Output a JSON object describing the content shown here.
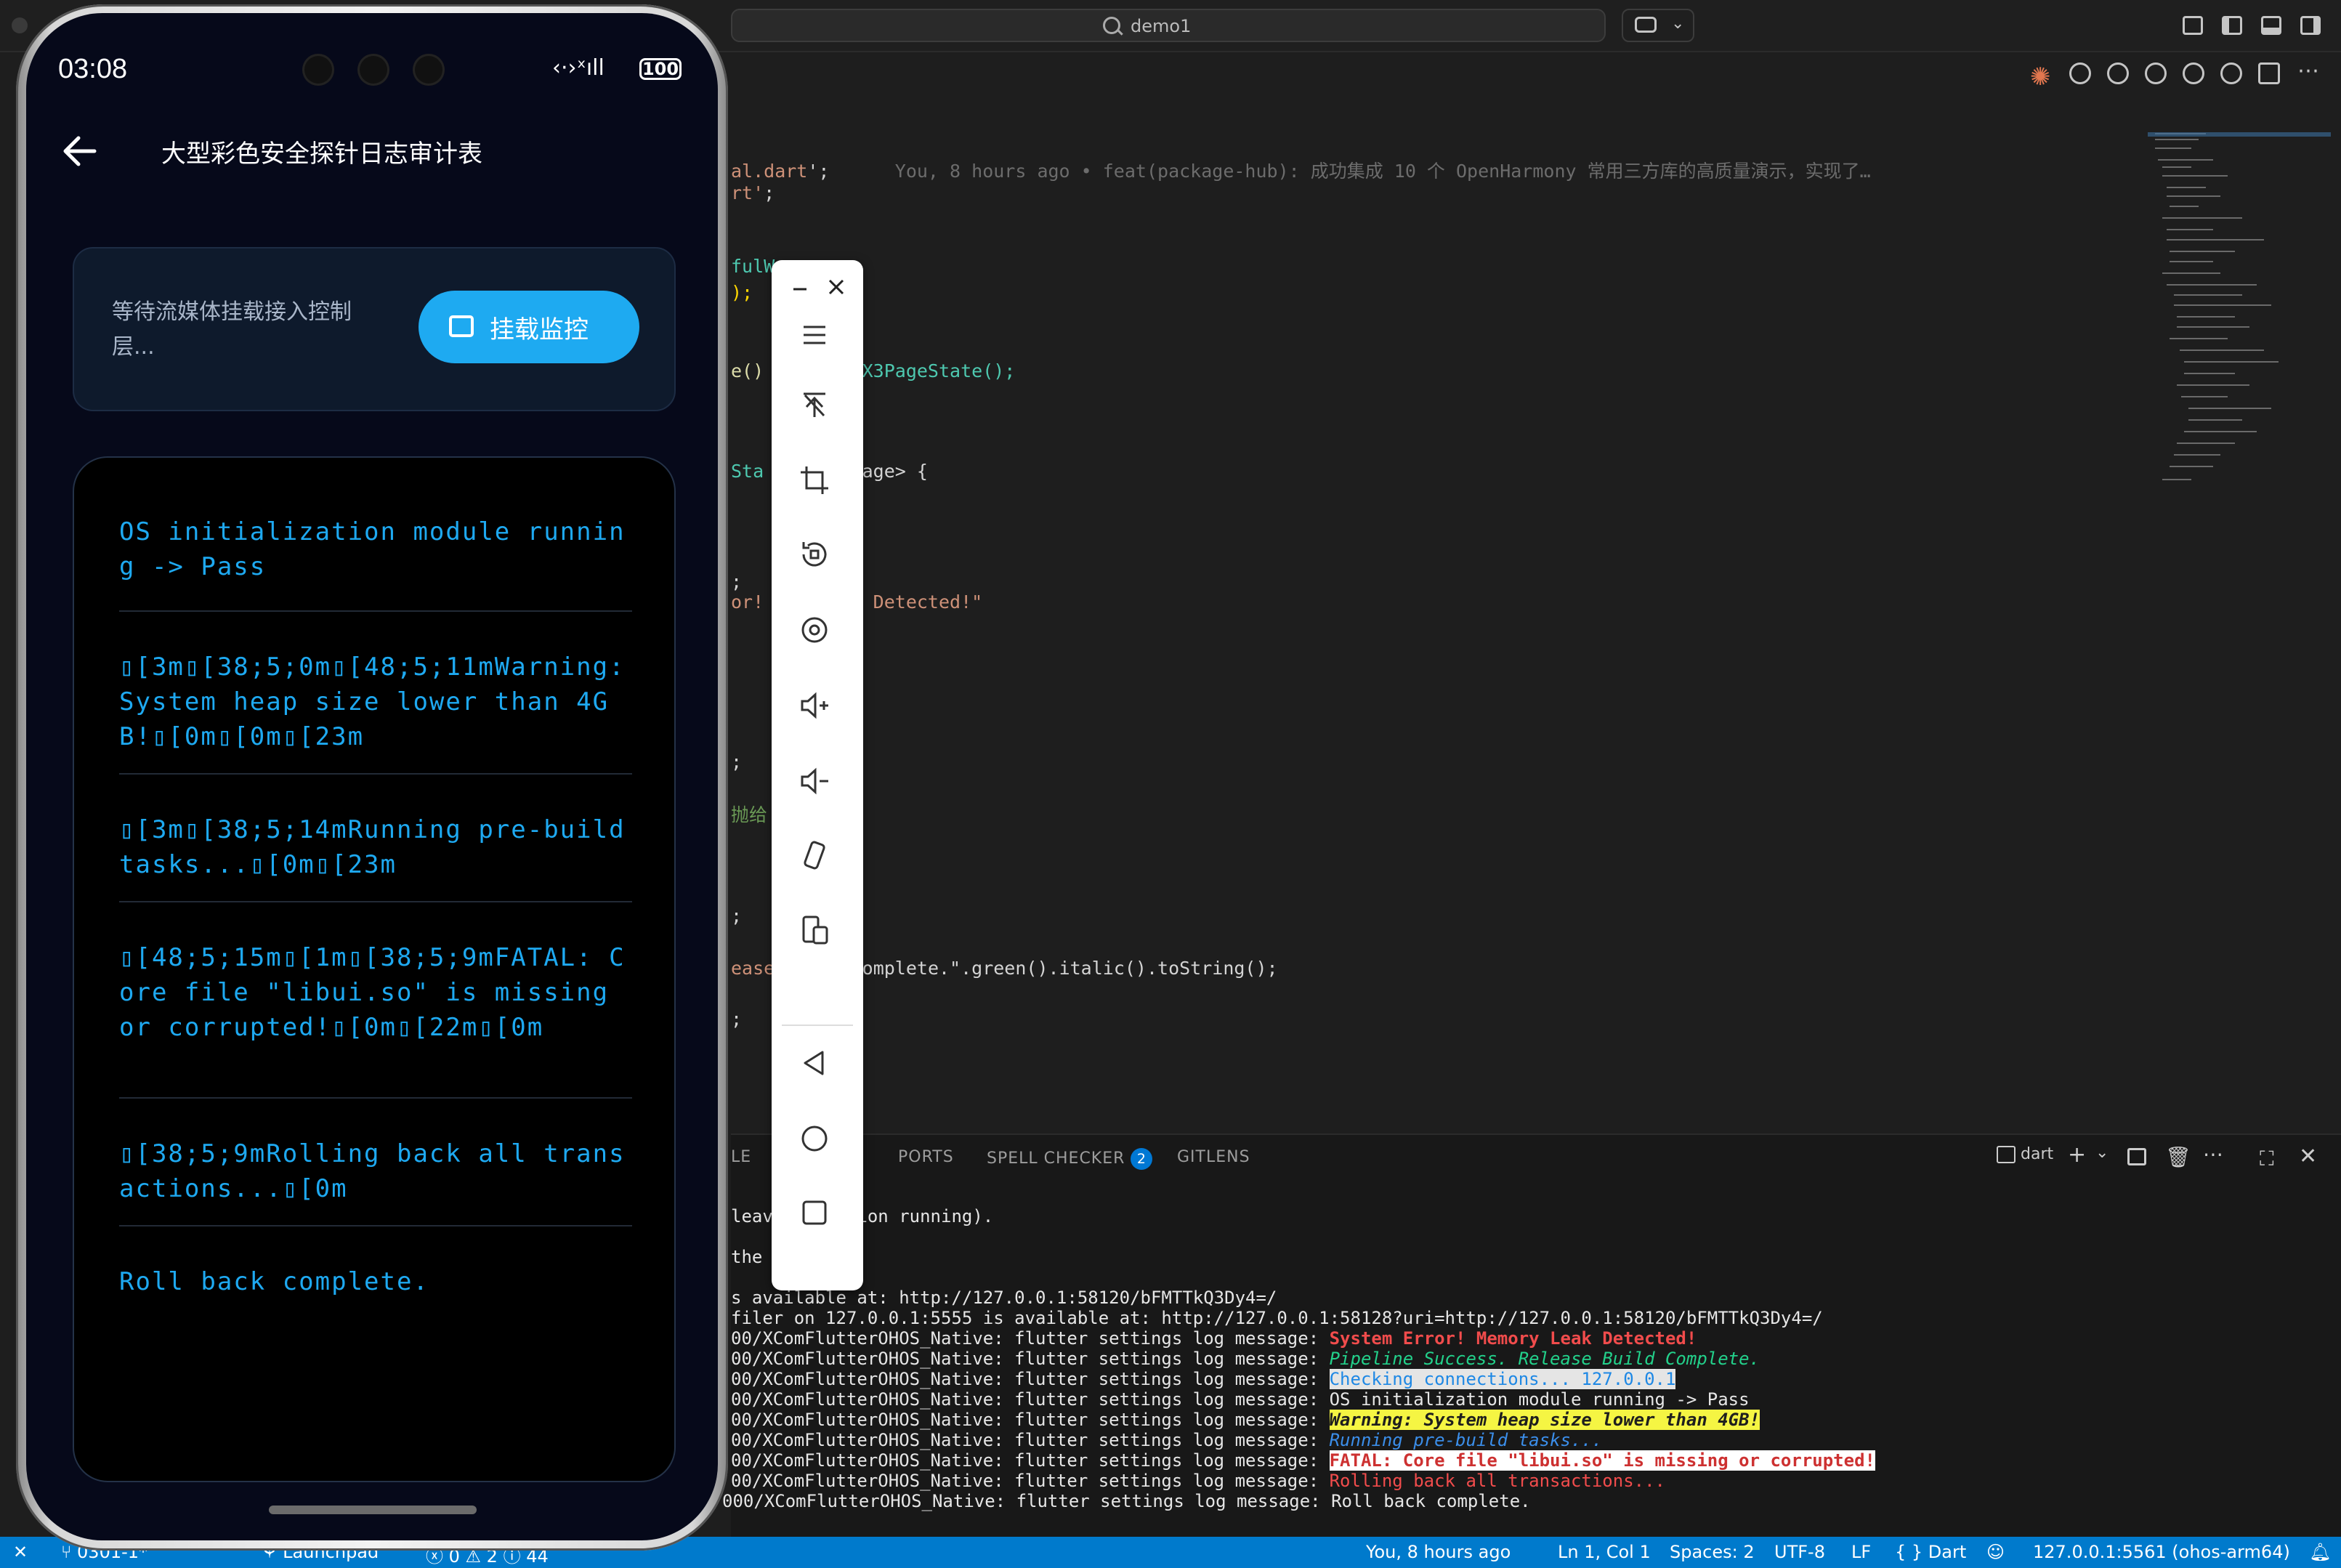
{
  "titlebar": {
    "search_text": "demo1"
  },
  "editor": {
    "lines": [
      {
        "t1": "al.dart",
        "t2": "';",
        "blame": "You, 8 hours ago • feat(package-hub): 成功集成 10 个 OpenHarmony 常用三方库的高质量演示，实现了…"
      },
      {
        "t1": "rt'",
        "t2": ";"
      },
      {
        "t1": "fulW"
      },
      {
        "t1": ");"
      },
      {
        "t1": "e()",
        "t2": "X3PageState();"
      },
      {
        "t1": "Sta",
        "t2": "3Page> {"
      },
      {
        "t1": ";"
      },
      {
        "t1": "or!",
        "t2": "eak Detected!\""
      },
      {
        "t1": ";"
      },
      {
        "t1": "抛给"
      },
      {
        "t1": ";"
      },
      {
        "t1": "ease",
        "t2": "omplete.\".green().italic().toString();"
      },
      {
        "t1": ";"
      }
    ]
  },
  "panel": {
    "tabs": {
      "le": "LE",
      "ports": "PORTS",
      "spell": "SPELL CHECKER",
      "spell_count": "2",
      "gitlens": "GITLENS"
    },
    "terminal_name": "dart",
    "terminal": {
      "l1": "leav",
      "l1b": "ation running).",
      "l2": "the c",
      "l3": "s available at: http://127.0.0.1:58120/bFMTTkQ3Dy4=/",
      "l4": "filer on 127.0.0.1:5555 is available at: http://127.0.0.1:58128?uri=http://127.0.0.1:58120/bFMTTkQ3Dy4=/",
      "prefix": "00/XComFlutterOHOS_Native: flutter settings log message: ",
      "prefix_last": "000/XComFlutterOHOS_Native: flutter settings log message: ",
      "m1": "System Error! Memory Leak Detected!",
      "m2": "Pipeline Success. Release Build Complete.",
      "m3": "Checking connections... 127.0.0.1",
      "m4": "OS initialization module running -> Pass",
      "m5": "Warning: System heap size lower than 4GB!",
      "m6": "Running pre-build tasks...",
      "m7": "FATAL: Core file \"libui.so\" is missing or corrupted!",
      "m8": "Rolling back all transactions...",
      "m9": "Roll back complete."
    }
  },
  "statusbar": {
    "branch": "0301-1*",
    "launchpad": "Launchpad",
    "problems": "0 ⚠ 2 ⓘ 44",
    "blame": "You, 8 hours ago",
    "position": "Ln 1, Col 1",
    "spaces": "Spaces: 2",
    "encoding": "UTF-8",
    "eol": "LF",
    "language": "{ } Dart",
    "device": "127.0.0.1:5561 (ohos-arm64)"
  },
  "phone": {
    "time": "03:08",
    "battery": "100",
    "app_title": "大型彩色安全探针日志审计表",
    "control_text": "等待流媒体挂载接入控制层...",
    "mount_button": "挂载监控",
    "logs": [
      "OS initialization module running -> Pass",
      "\u0000[3m\u0000[38;5;0m\u0000[48;5;11mWarning: System heap size lower than 4GB!\u0000[0m\u0000[0m\u0000[23m",
      "\u0000[3m\u0000[38;5;14mRunning pre-build tasks...\u0000[0m\u0000[23m",
      "\u0000[48;5;15m\u0000[1m\u0000[38;5;9mFATAL: Core file \"libui.so\" is missing or corrupted!\u0000[0m\u0000[22m\u0000[0m",
      "\u0000[38;5;9mRolling back all transactions...\u0000[0m",
      "Roll back complete."
    ]
  },
  "colors": {
    "accent": "#1eaaf1",
    "log_text": "#1ea9f1",
    "statusbar": "#007acc"
  }
}
